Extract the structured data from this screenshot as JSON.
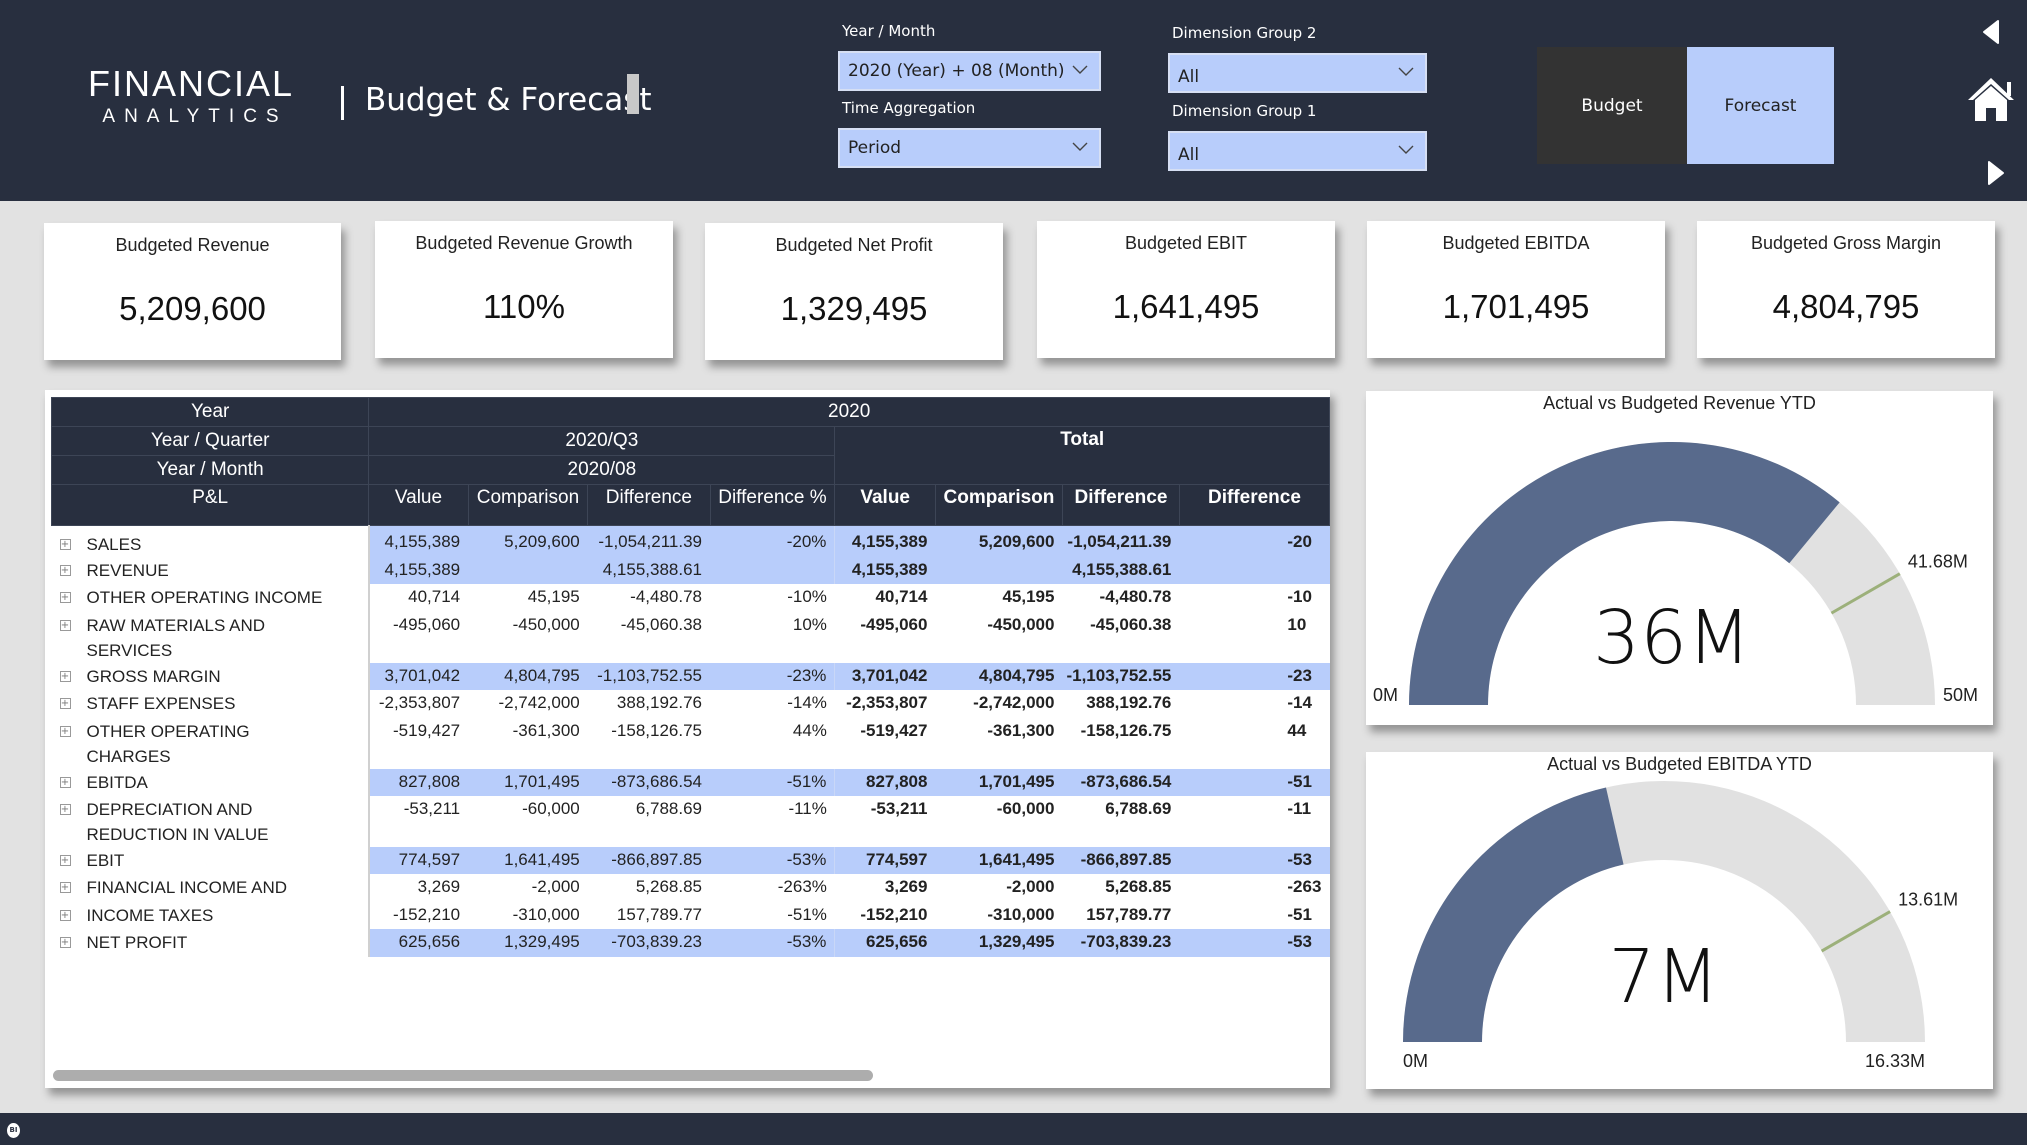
{
  "header": {
    "logo_line1": "FINANCIAL",
    "logo_line2": "ANALYTICS",
    "title": "Budget & Forecast"
  },
  "filters": {
    "year_month": {
      "label": "Year / Month",
      "value": "2020 (Year) + 08 (Month)"
    },
    "time_aggregation": {
      "label": "Time Aggregation",
      "value": "Period"
    },
    "dimension_group_2": {
      "label": "Dimension Group 2",
      "value": "All"
    },
    "dimension_group_1": {
      "label": "Dimension Group 1",
      "value": "All"
    }
  },
  "scenario_toggle": {
    "budget_label": "Budget",
    "forecast_label": "Forecast",
    "selected": "Forecast"
  },
  "nav": {
    "back_icon": "triangle-left-icon",
    "home_icon": "home-icon",
    "forward_icon": "triangle-right-icon"
  },
  "kpis": [
    {
      "title": "Budgeted Revenue",
      "value": "5,209,600"
    },
    {
      "title": "Budgeted Revenue Growth",
      "value": "110%"
    },
    {
      "title": "Budgeted Net Profit",
      "value": "1,329,495"
    },
    {
      "title": "Budgeted EBIT",
      "value": "1,641,495"
    },
    {
      "title": "Budgeted EBITDA",
      "value": "1,701,495"
    },
    {
      "title": "Budgeted Gross Margin",
      "value": "4,804,795"
    }
  ],
  "matrix": {
    "row_headers": {
      "year": "Year",
      "quarter": "Year / Quarter",
      "month": "Year / Month",
      "pl": "P&L"
    },
    "col_year": "2020",
    "col_quarter": "2020/Q3",
    "col_month": "2020/08",
    "col_total": "Total",
    "measures": [
      "Value",
      "Comparison",
      "Difference",
      "Difference %"
    ],
    "total_measures": [
      "Value",
      "Comparison",
      "Difference",
      "Difference"
    ],
    "rows": [
      {
        "label": "SALES",
        "hl": true,
        "v": "4,155,389",
        "c": "5,209,600",
        "d": "-1,054,211.39",
        "p": "-20%",
        "tv": "4,155,389",
        "tc": "5,209,600",
        "td": "-1,054,211.39",
        "tp": "-20"
      },
      {
        "label": "REVENUE",
        "hl": true,
        "v": "4,155,389",
        "c": "",
        "d": "4,155,388.61",
        "p": "",
        "tv": "4,155,389",
        "tc": "",
        "td": "4,155,388.61",
        "tp": ""
      },
      {
        "label": "OTHER OPERATING INCOME",
        "hl": false,
        "v": "40,714",
        "c": "45,195",
        "d": "-4,480.78",
        "p": "-10%",
        "tv": "40,714",
        "tc": "45,195",
        "td": "-4,480.78",
        "tp": "-10"
      },
      {
        "label": "RAW MATERIALS AND SERVICES",
        "hl": false,
        "v": "-495,060",
        "c": "-450,000",
        "d": "-45,060.38",
        "p": "10%",
        "tv": "-495,060",
        "tc": "-450,000",
        "td": "-45,060.38",
        "tp": "10"
      },
      {
        "label": "GROSS MARGIN",
        "hl": true,
        "v": "3,701,042",
        "c": "4,804,795",
        "d": "-1,103,752.55",
        "p": "-23%",
        "tv": "3,701,042",
        "tc": "4,804,795",
        "td": "-1,103,752.55",
        "tp": "-23"
      },
      {
        "label": "STAFF EXPENSES",
        "hl": false,
        "v": "-2,353,807",
        "c": "-2,742,000",
        "d": "388,192.76",
        "p": "-14%",
        "tv": "-2,353,807",
        "tc": "-2,742,000",
        "td": "388,192.76",
        "tp": "-14"
      },
      {
        "label": "OTHER OPERATING CHARGES",
        "hl": false,
        "v": "-519,427",
        "c": "-361,300",
        "d": "-158,126.75",
        "p": "44%",
        "tv": "-519,427",
        "tc": "-361,300",
        "td": "-158,126.75",
        "tp": "44"
      },
      {
        "label": "EBITDA",
        "hl": true,
        "v": "827,808",
        "c": "1,701,495",
        "d": "-873,686.54",
        "p": "-51%",
        "tv": "827,808",
        "tc": "1,701,495",
        "td": "-873,686.54",
        "tp": "-51"
      },
      {
        "label": "DEPRECIATION AND REDUCTION IN VALUE",
        "hl": false,
        "v": "-53,211",
        "c": "-60,000",
        "d": "6,788.69",
        "p": "-11%",
        "tv": "-53,211",
        "tc": "-60,000",
        "td": "6,788.69",
        "tp": "-11"
      },
      {
        "label": "EBIT",
        "hl": true,
        "v": "774,597",
        "c": "1,641,495",
        "d": "-866,897.85",
        "p": "-53%",
        "tv": "774,597",
        "tc": "1,641,495",
        "td": "-866,897.85",
        "tp": "-53"
      },
      {
        "label": "FINANCIAL INCOME AND",
        "hl": false,
        "v": "3,269",
        "c": "-2,000",
        "d": "5,268.85",
        "p": "-263%",
        "tv": "3,269",
        "tc": "-2,000",
        "td": "5,268.85",
        "tp": "-263"
      },
      {
        "label": "INCOME TAXES",
        "hl": false,
        "v": "-152,210",
        "c": "-310,000",
        "d": "157,789.77",
        "p": "-51%",
        "tv": "-152,210",
        "tc": "-310,000",
        "td": "157,789.77",
        "tp": "-51"
      },
      {
        "label": "NET PROFIT",
        "hl": true,
        "v": "625,656",
        "c": "1,329,495",
        "d": "-703,839.23",
        "p": "-53%",
        "tv": "625,656",
        "tc": "1,329,495",
        "td": "-703,839.23",
        "tp": "-53"
      }
    ]
  },
  "gauges": [
    {
      "title": "Actual vs Budgeted Revenue YTD",
      "value": 36,
      "value_label": "36M",
      "min": 0,
      "min_label": "0M",
      "max": 50,
      "max_label": "50M",
      "target": 41.68,
      "target_label": "41.68M"
    },
    {
      "title": "Actual vs Budgeted EBITDA YTD",
      "value": 7,
      "value_label": "7M",
      "min": 0,
      "min_label": "0M",
      "max": 16.33,
      "max_label": "16.33M",
      "target": 13.61,
      "target_label": "13.61M"
    }
  ],
  "colors": {
    "header_bg": "#282f3f",
    "accent": "#b8cdfb",
    "gauge_fill": "#586a8c",
    "gauge_track": "#e1e1e1",
    "gauge_target": "#9cb07a",
    "budget_button": "#333333"
  },
  "footer": {
    "badge": "BI"
  }
}
